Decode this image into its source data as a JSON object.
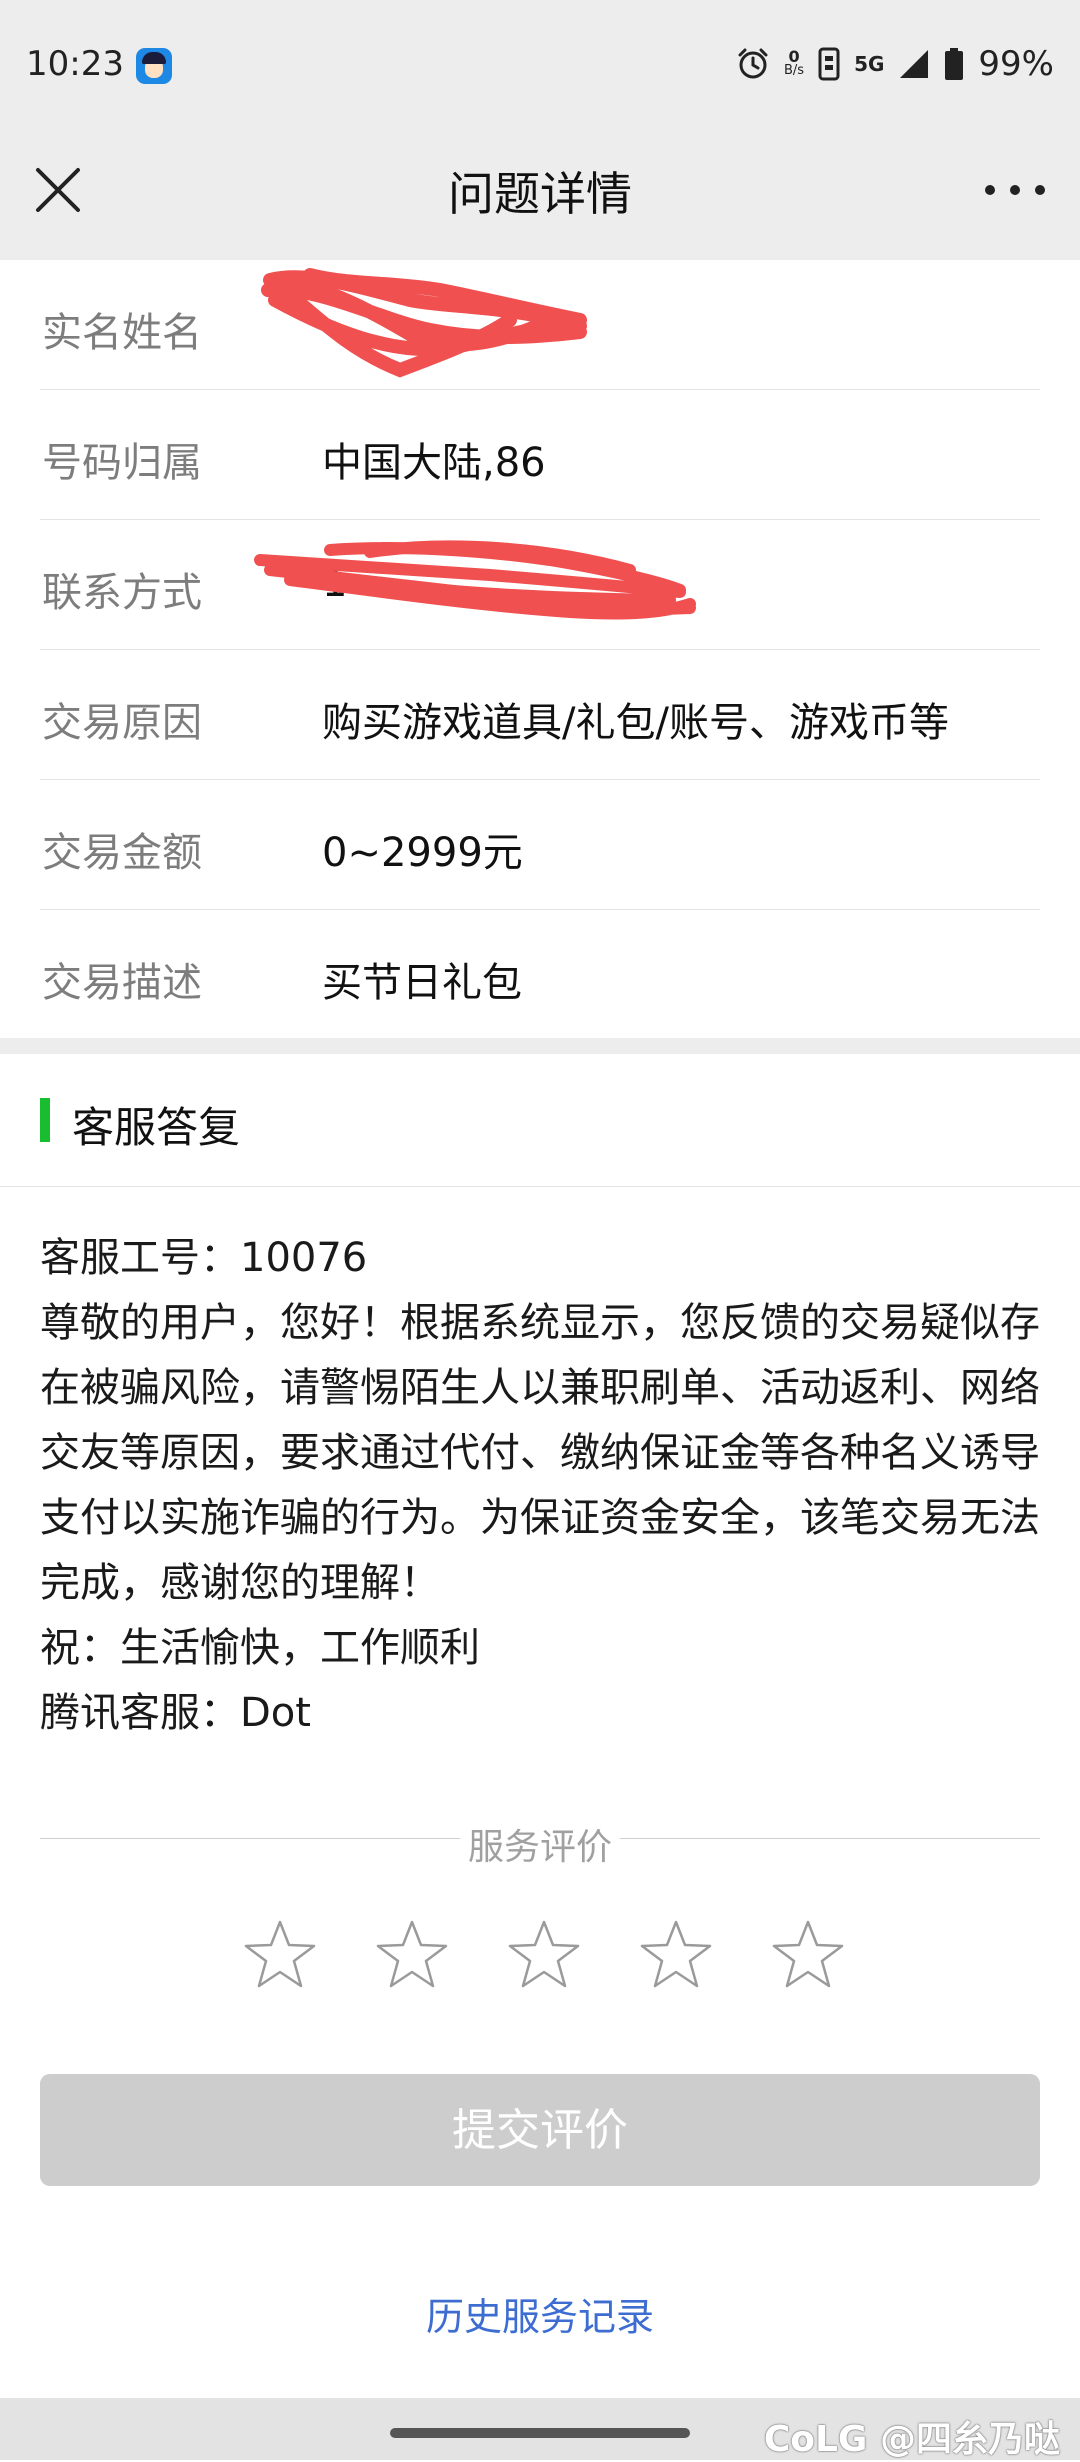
{
  "status_bar": {
    "time": "10:23",
    "net_speed_value": "0",
    "net_speed_unit": "B/s",
    "network": "5G",
    "battery": "99%"
  },
  "nav": {
    "title": "问题详情",
    "close_icon": "close-icon",
    "more_icon": "more-icon"
  },
  "info_rows": [
    {
      "label": "实名姓名",
      "value": ""
    },
    {
      "label": "号码归属",
      "value": "中国大陆,86"
    },
    {
      "label": "联系方式",
      "value": "1"
    },
    {
      "label": "交易原因",
      "value": "购买游戏道具/礼包/账号、游戏币等"
    },
    {
      "label": "交易金额",
      "value": "0~2999元"
    },
    {
      "label": "交易描述",
      "value": "买节日礼包"
    }
  ],
  "reply_section": {
    "title": "客服答复",
    "accent_color": "#19be30",
    "lines": [
      "客服工号：10076",
      "尊敬的用户，您好！根据系统显示，您反馈的交易疑似存在被骗风险，请警惕陌生人以兼职刷单、活动返利、网络交友等原因，要求通过代付、缴纳保证金等各种名义诱导支付以实施诈骗的行为。为保证资金安全，该笔交易无法完成，感谢您的理解！",
      "祝：生活愉快，工作顺利",
      "腾讯客服：Dot"
    ]
  },
  "rating": {
    "label": "服务评价",
    "star_count": 5,
    "selected": 0,
    "submit_label": "提交评价"
  },
  "history_link": "历史服务记录",
  "watermark": "CoLG @四糸乃哒",
  "colors": {
    "link": "#3e6dd1",
    "redaction": "#f0504f",
    "button_disabled": "#cdcdcd"
  }
}
